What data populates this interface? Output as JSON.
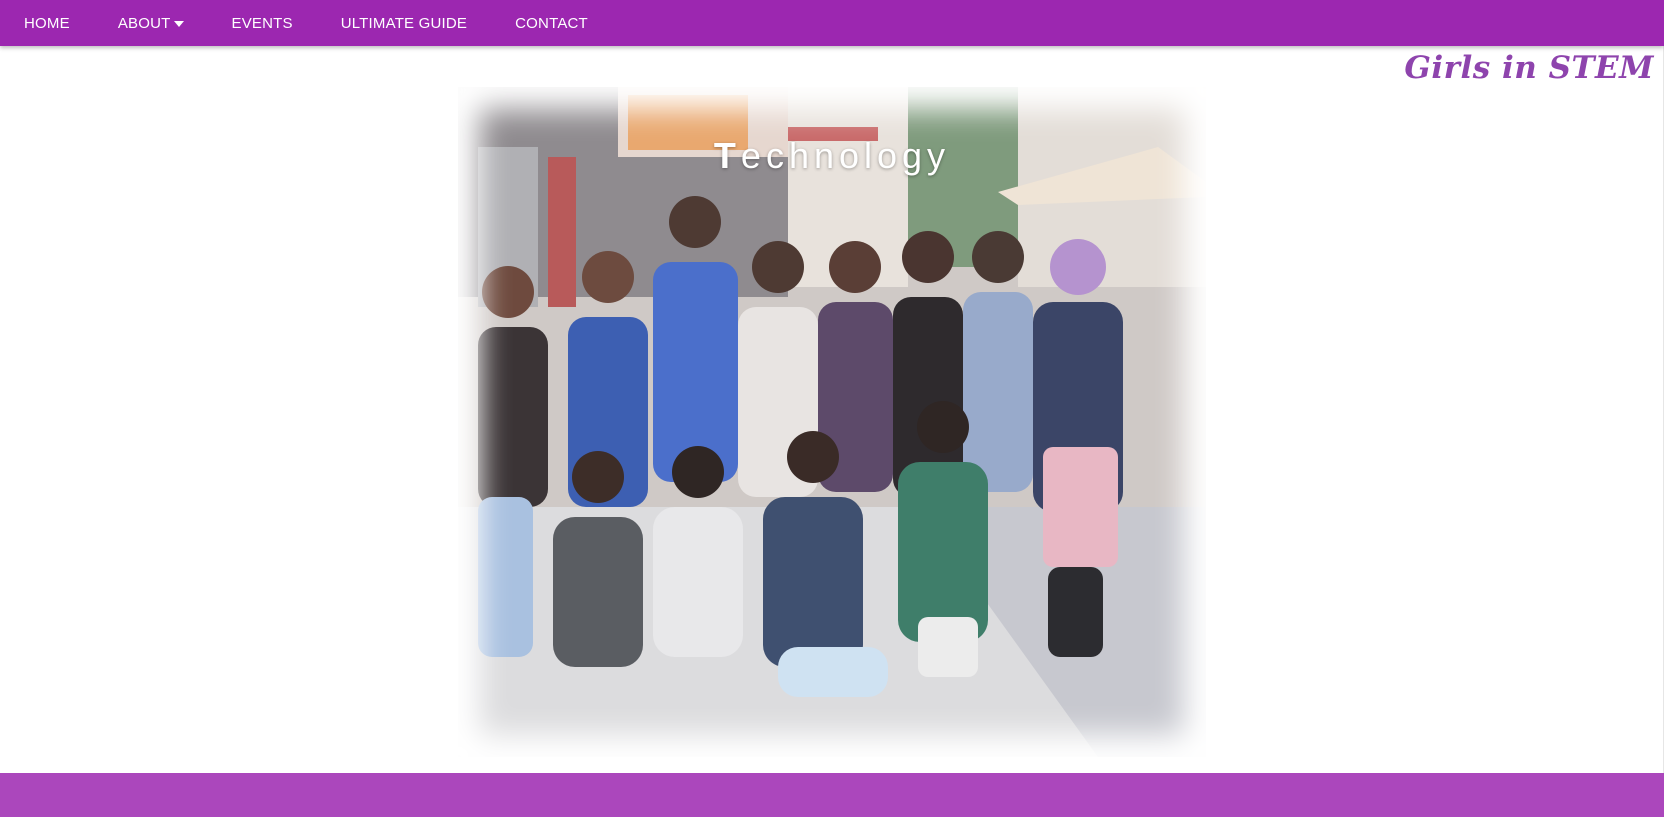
{
  "nav": {
    "items": [
      {
        "label": "HOME"
      },
      {
        "label": "ABOUT"
      },
      {
        "label": "EVENTS"
      },
      {
        "label": "ULTIMATE GUIDE"
      },
      {
        "label": "CONTACT"
      }
    ],
    "about_caret_icon": "caret-down-icon"
  },
  "brand": {
    "name": "Girls in STEM"
  },
  "hero": {
    "title_first": "T",
    "title_rest": "echnology"
  },
  "colors": {
    "nav_bg": "#9c27b0",
    "footer_bg": "#ab47bc",
    "brand_text": "#8e44ad"
  }
}
